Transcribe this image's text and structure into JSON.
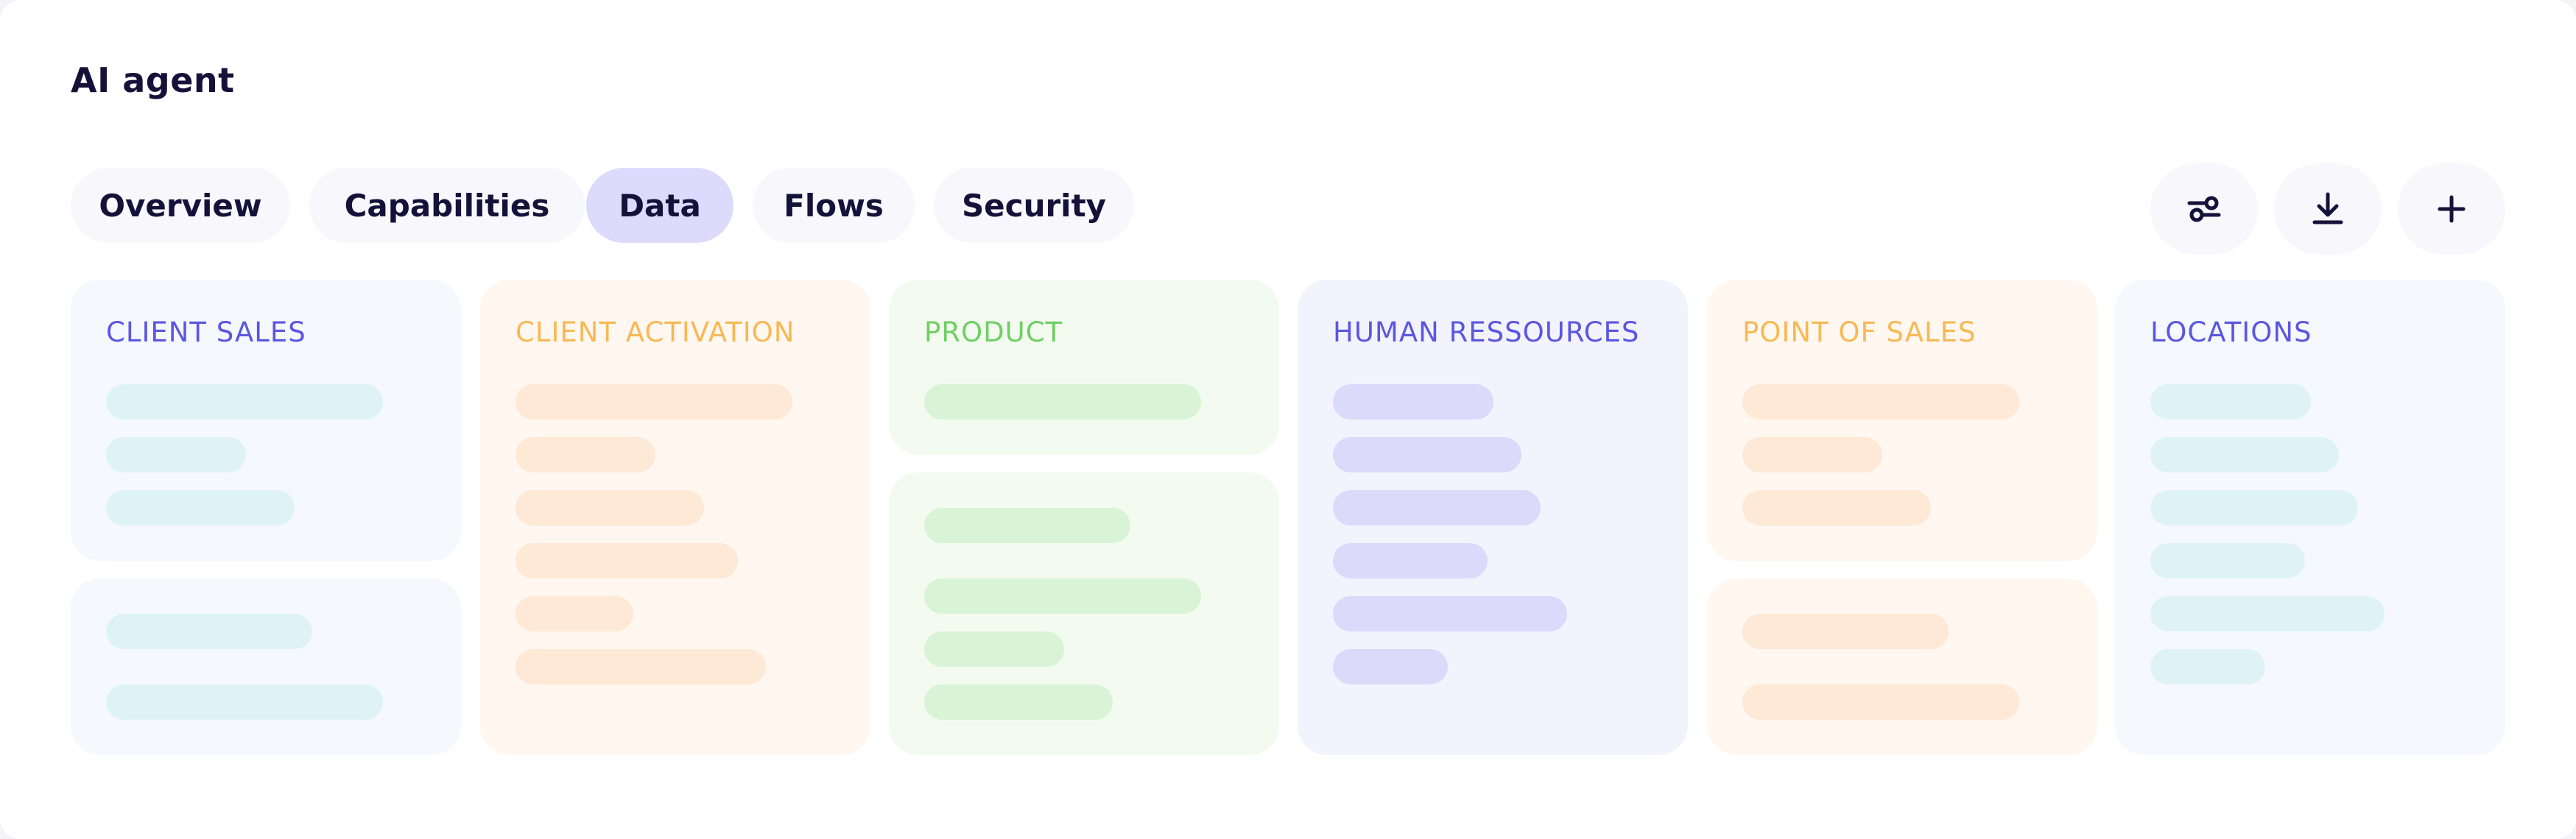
{
  "header": {
    "title": "AI agent"
  },
  "tabs": [
    {
      "label": "Overview",
      "active": false
    },
    {
      "label": "Capabilities",
      "active": false
    },
    {
      "label": "Data",
      "active": true
    },
    {
      "label": "Flows",
      "active": false
    },
    {
      "label": "Security",
      "active": false
    }
  ],
  "actions": [
    {
      "icon": "sliders-icon"
    },
    {
      "icon": "download-icon"
    },
    {
      "icon": "plus-icon"
    }
  ],
  "columns": [
    {
      "title": "CLIENT SALES",
      "theme": "blue"
    },
    {
      "title": "CLIENT ACTIVATION",
      "theme": "orange"
    },
    {
      "title": "PRODUCT",
      "theme": "green"
    },
    {
      "title": "HUMAN RESSOURCES",
      "theme": "purple"
    },
    {
      "title": "POINT OF SALES",
      "theme": "orange"
    },
    {
      "title": "LOCATIONS",
      "theme": "blue"
    }
  ],
  "colors": {
    "accent": "#5b57e0",
    "active_tab": "#dcdbfb",
    "orange_title": "#f7b955",
    "green_title": "#6fcf63"
  }
}
